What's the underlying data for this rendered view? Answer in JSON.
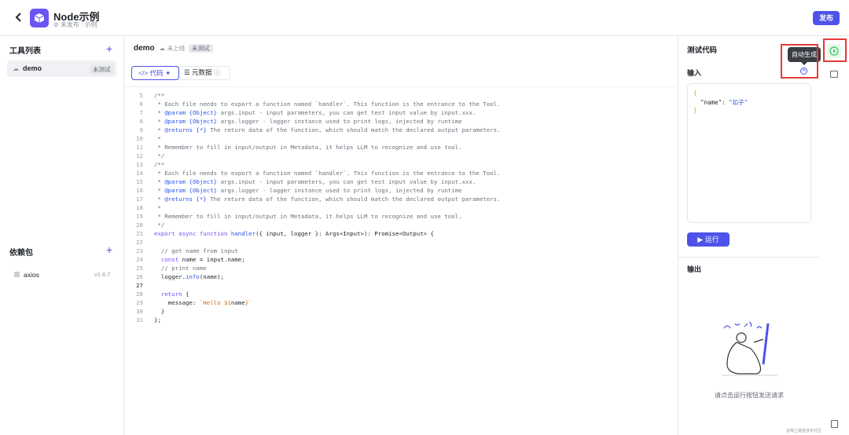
{
  "header": {
    "title": "Node示例",
    "status": "未发布",
    "tag": "示例",
    "publish_label": "发布"
  },
  "sidebar": {
    "tools_title": "工具列表",
    "tools": [
      {
        "name": "demo",
        "badge": "未测试"
      }
    ],
    "deps_title": "依赖包",
    "deps": [
      {
        "name": "axios",
        "version": "v1.6.7"
      }
    ]
  },
  "editor": {
    "file_name": "demo",
    "upload_status": "未上线",
    "test_badge": "未测试",
    "tab_code": "代码",
    "tab_metadata": "元数据"
  },
  "test_panel": {
    "title": "测试代码",
    "input_title": "输入",
    "input_key": "\"name\"",
    "input_value": "\"扣子\"",
    "run_label": "运行",
    "output_title": "输出",
    "empty_text": "请点击运行按钮发送请求",
    "tooltip": "自动生成"
  },
  "watermark": "@稀土掘金技术社区",
  "colors": {
    "accent": "#4d53e8",
    "highlight": "#e53935",
    "run_icon": "#34c759"
  }
}
